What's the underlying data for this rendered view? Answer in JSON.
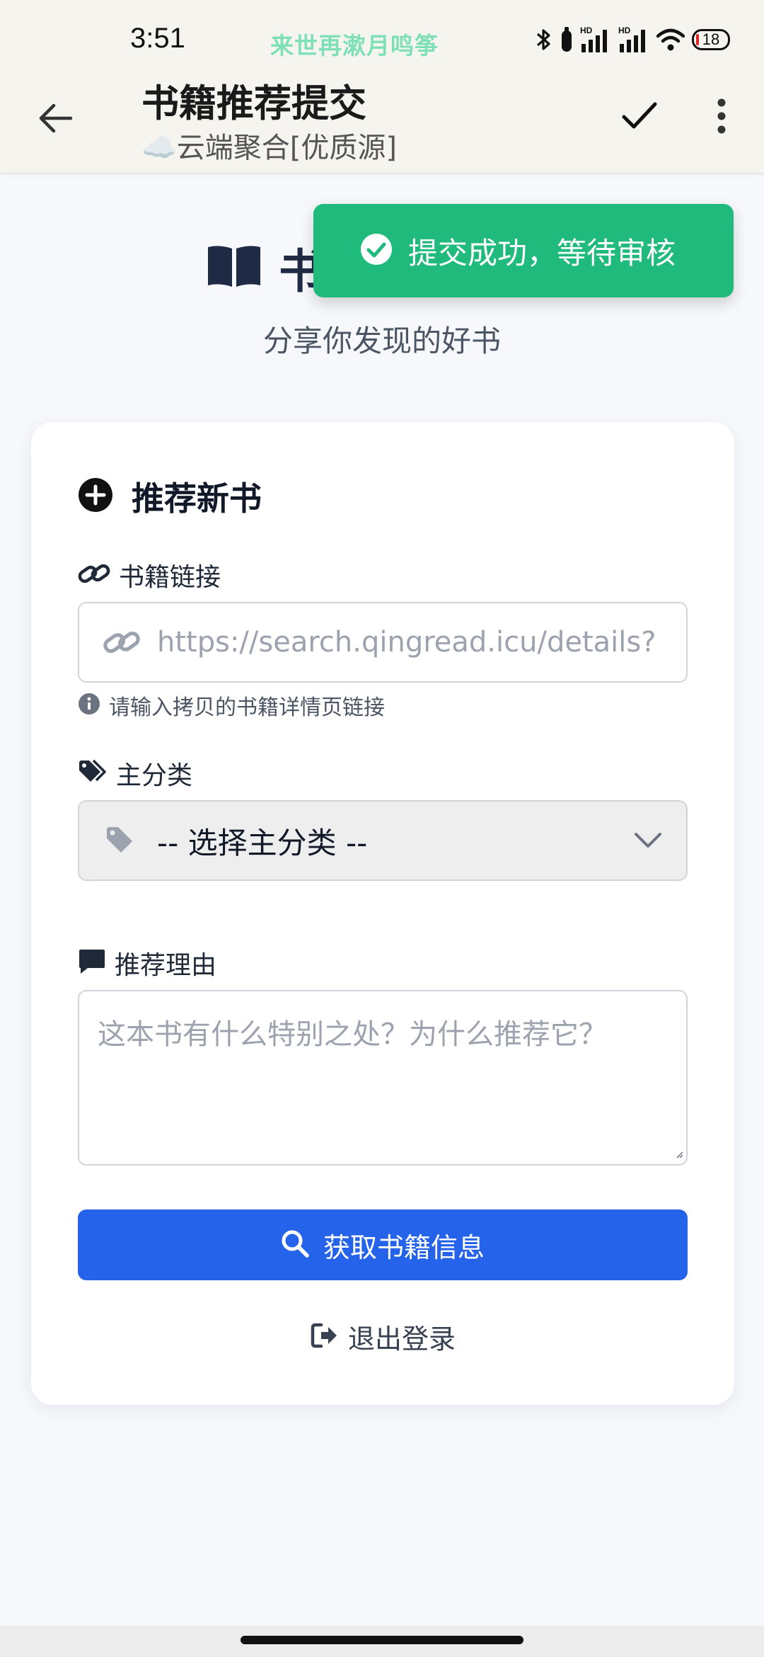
{
  "status_bar": {
    "time": "3:51",
    "ticker": "来世再漱月鸣筝",
    "battery": "18",
    "icons": [
      "bluetooth-icon",
      "alarm-icon",
      "signal-hd-1-icon",
      "signal-hd-2-icon",
      "wifi-icon",
      "battery-icon"
    ]
  },
  "app_bar": {
    "title": "书籍推荐提交",
    "subtitle": "☁️云端聚合[优质源]",
    "icons": [
      "back-arrow-icon",
      "checkmark-icon",
      "more-vertical-icon"
    ]
  },
  "page": {
    "title": "书",
    "tagline": "分享你发现的好书",
    "title_icon": "open-book-icon"
  },
  "toast": {
    "message": "提交成功，等待审核",
    "icon": "check-circle-icon",
    "color": "#1fba7c"
  },
  "form": {
    "section_title": "推荐新书",
    "link_label": "书籍链接",
    "link_placeholder": "https://search.qingread.icu/details?",
    "link_hint": "请输入拷贝的书籍详情页链接",
    "category_label": "主分类",
    "category_selected": "-- 选择主分类 --",
    "reason_label": "推荐理由",
    "reason_placeholder": "这本书有什么特别之处？为什么推荐它？",
    "fetch_button": "获取书籍信息",
    "logout": "退出登录",
    "accent_color": "#2563eb"
  }
}
